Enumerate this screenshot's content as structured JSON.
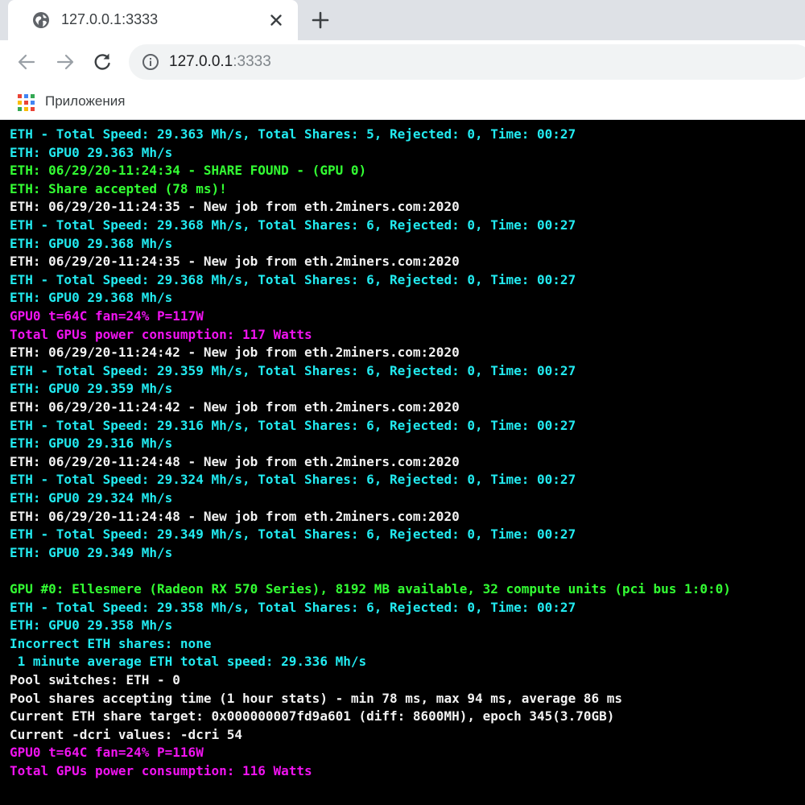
{
  "browser": {
    "tab": {
      "title": "127.0.0.1:3333",
      "icon": "globe-icon"
    },
    "address": {
      "host": "127.0.0.1",
      "port": ":3333"
    },
    "bookmarks": {
      "apps_label": "Приложения"
    }
  },
  "colors": {
    "cyan": "#22eaf0",
    "white": "#f2f2f2",
    "green": "#33ff33",
    "magenta": "#f013f0"
  },
  "terminal": {
    "lines": [
      {
        "text": "ETH - Total Speed: 29.363 Mh/s, Total Shares: 5, Rejected: 0, Time: 00:27",
        "color": "cyan"
      },
      {
        "text": "ETH: GPU0 29.363 Mh/s",
        "color": "cyan"
      },
      {
        "text": "ETH: 06/29/20-11:24:34 - SHARE FOUND - (GPU 0)",
        "color": "green"
      },
      {
        "text": "ETH: Share accepted (78 ms)!",
        "color": "green"
      },
      {
        "text": "ETH: 06/29/20-11:24:35 - New job from eth.2miners.com:2020",
        "color": "white"
      },
      {
        "text": "ETH - Total Speed: 29.368 Mh/s, Total Shares: 6, Rejected: 0, Time: 00:27",
        "color": "cyan"
      },
      {
        "text": "ETH: GPU0 29.368 Mh/s",
        "color": "cyan"
      },
      {
        "text": "ETH: 06/29/20-11:24:35 - New job from eth.2miners.com:2020",
        "color": "white"
      },
      {
        "text": "ETH - Total Speed: 29.368 Mh/s, Total Shares: 6, Rejected: 0, Time: 00:27",
        "color": "cyan"
      },
      {
        "text": "ETH: GPU0 29.368 Mh/s",
        "color": "cyan"
      },
      {
        "text": "GPU0 t=64C fan=24% P=117W",
        "color": "magenta"
      },
      {
        "text": "Total GPUs power consumption: 117 Watts",
        "color": "magenta"
      },
      {
        "text": "ETH: 06/29/20-11:24:42 - New job from eth.2miners.com:2020",
        "color": "white"
      },
      {
        "text": "ETH - Total Speed: 29.359 Mh/s, Total Shares: 6, Rejected: 0, Time: 00:27",
        "color": "cyan"
      },
      {
        "text": "ETH: GPU0 29.359 Mh/s",
        "color": "cyan"
      },
      {
        "text": "ETH: 06/29/20-11:24:42 - New job from eth.2miners.com:2020",
        "color": "white"
      },
      {
        "text": "ETH - Total Speed: 29.316 Mh/s, Total Shares: 6, Rejected: 0, Time: 00:27",
        "color": "cyan"
      },
      {
        "text": "ETH: GPU0 29.316 Mh/s",
        "color": "cyan"
      },
      {
        "text": "ETH: 06/29/20-11:24:48 - New job from eth.2miners.com:2020",
        "color": "white"
      },
      {
        "text": "ETH - Total Speed: 29.324 Mh/s, Total Shares: 6, Rejected: 0, Time: 00:27",
        "color": "cyan"
      },
      {
        "text": "ETH: GPU0 29.324 Mh/s",
        "color": "cyan"
      },
      {
        "text": "ETH: 06/29/20-11:24:48 - New job from eth.2miners.com:2020",
        "color": "white"
      },
      {
        "text": "ETH - Total Speed: 29.349 Mh/s, Total Shares: 6, Rejected: 0, Time: 00:27",
        "color": "cyan"
      },
      {
        "text": "ETH: GPU0 29.349 Mh/s",
        "color": "cyan"
      },
      {
        "text": "",
        "color": "white"
      },
      {
        "text": "GPU #0: Ellesmere (Radeon RX 570 Series), 8192 MB available, 32 compute units (pci bus 1:0:0)",
        "color": "green"
      },
      {
        "text": "ETH - Total Speed: 29.358 Mh/s, Total Shares: 6, Rejected: 0, Time: 00:27",
        "color": "cyan"
      },
      {
        "text": "ETH: GPU0 29.358 Mh/s",
        "color": "cyan"
      },
      {
        "text": "Incorrect ETH shares: none",
        "color": "cyan"
      },
      {
        "text": " 1 minute average ETH total speed: 29.336 Mh/s",
        "color": "cyan"
      },
      {
        "text": "Pool switches: ETH - 0",
        "color": "white"
      },
      {
        "text": "Pool shares accepting time (1 hour stats) - min 78 ms, max 94 ms, average 86 ms",
        "color": "white"
      },
      {
        "text": "Current ETH share target: 0x000000007fd9a601 (diff: 8600MH), epoch 345(3.70GB)",
        "color": "white"
      },
      {
        "text": "Current -dcri values: -dcri 54",
        "color": "white"
      },
      {
        "text": "GPU0 t=64C fan=24% P=116W",
        "color": "magenta"
      },
      {
        "text": "Total GPUs power consumption: 116 Watts",
        "color": "magenta"
      }
    ]
  }
}
